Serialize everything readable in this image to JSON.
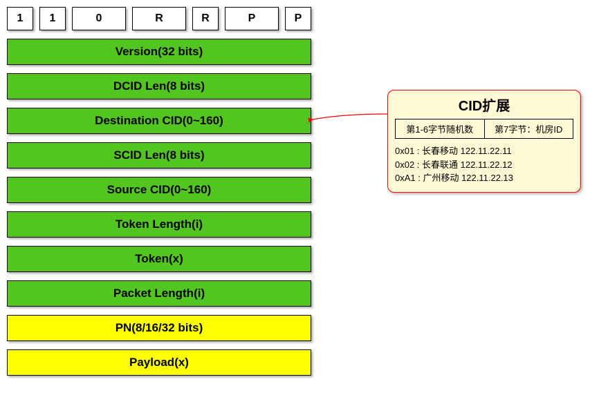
{
  "bits": [
    "1",
    "1",
    "0",
    "R",
    "R",
    "P",
    "P"
  ],
  "fields": [
    {
      "label": "Version(32 bits)",
      "color": "green"
    },
    {
      "label": "DCID Len(8 bits)",
      "color": "green"
    },
    {
      "label": "Destination CID(0~160)",
      "color": "green"
    },
    {
      "label": "SCID Len(8 bits)",
      "color": "green"
    },
    {
      "label": "Source CID(0~160)",
      "color": "green"
    },
    {
      "label": "Token Length(i)",
      "color": "green"
    },
    {
      "label": "Token(x)",
      "color": "green"
    },
    {
      "label": "Packet Length(i)",
      "color": "green"
    },
    {
      "label": "PN(8/16/32 bits)",
      "color": "yellow"
    },
    {
      "label": "Payload(x)",
      "color": "yellow"
    }
  ],
  "panel": {
    "title": "CID扩展",
    "col1": "第1-6字节随机数",
    "col2": "第7字节：机房ID",
    "lines": [
      "0x01 : 长春移动 122.11.22.11",
      "0x02 : 长春联通 122.11.22.12",
      "0xA1 : 广州移动 122.11.22.13"
    ]
  }
}
